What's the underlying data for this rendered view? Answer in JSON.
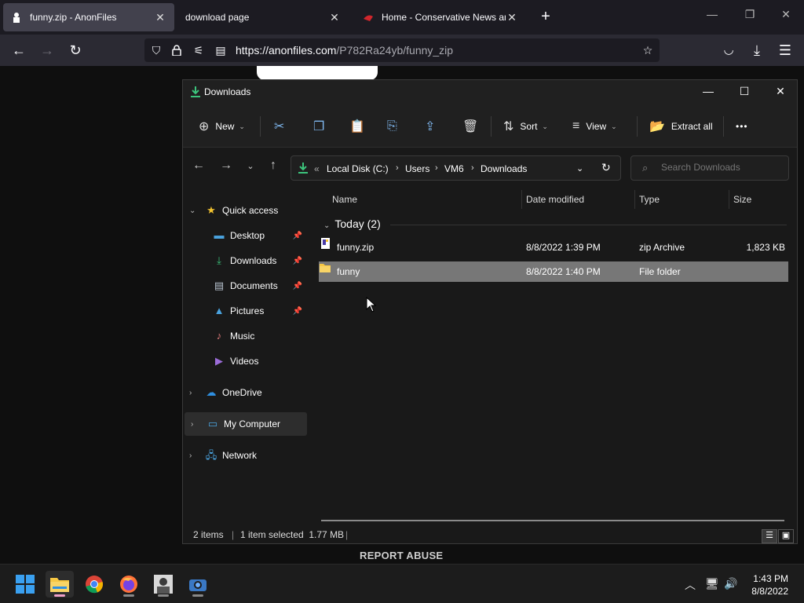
{
  "browser": {
    "tabs": [
      {
        "title": "funny.zip - AnonFiles",
        "active": true
      },
      {
        "title": "download page",
        "active": false
      },
      {
        "title": "Home - Conservative News an",
        "active": false
      }
    ],
    "new_tab_label": "+",
    "url_host": "https://anonfiles.com",
    "url_path": "/P782Ra24yb/funny_zip"
  },
  "webpage": {
    "report_abuse": "REPORT ABUSE"
  },
  "explorer": {
    "title": "Downloads",
    "toolbar": {
      "new_label": "New",
      "sort_label": "Sort",
      "view_label": "View",
      "extract_label": "Extract all",
      "more_label": "•••"
    },
    "breadcrumb": {
      "overflow": "«",
      "items": [
        "Local Disk (C:)",
        "Users",
        "VM6",
        "Downloads"
      ]
    },
    "search_placeholder": "Search Downloads",
    "nav": {
      "quick_access": "Quick access",
      "items": [
        "Desktop",
        "Downloads",
        "Documents",
        "Pictures",
        "Music",
        "Videos"
      ],
      "onedrive": "OneDrive",
      "my_computer": "My Computer",
      "network": "Network"
    },
    "columns": {
      "name": "Name",
      "date": "Date modified",
      "type": "Type",
      "size": "Size"
    },
    "group": "Today (2)",
    "files": [
      {
        "name": "funny.zip",
        "date": "8/8/2022 1:39 PM",
        "type": "zip Archive",
        "size": "1,823 KB",
        "selected": false
      },
      {
        "name": "funny",
        "date": "8/8/2022 1:40 PM",
        "type": "File folder",
        "size": "",
        "selected": true
      }
    ],
    "status": {
      "count": "2 items",
      "selection": "1 item selected  1.77 MB"
    }
  },
  "taskbar": {
    "time": "1:43 PM",
    "date": "8/8/2022"
  },
  "colors": {
    "accent": "#0078d4",
    "folder": "#f6c744",
    "selected_row": "#777777"
  }
}
